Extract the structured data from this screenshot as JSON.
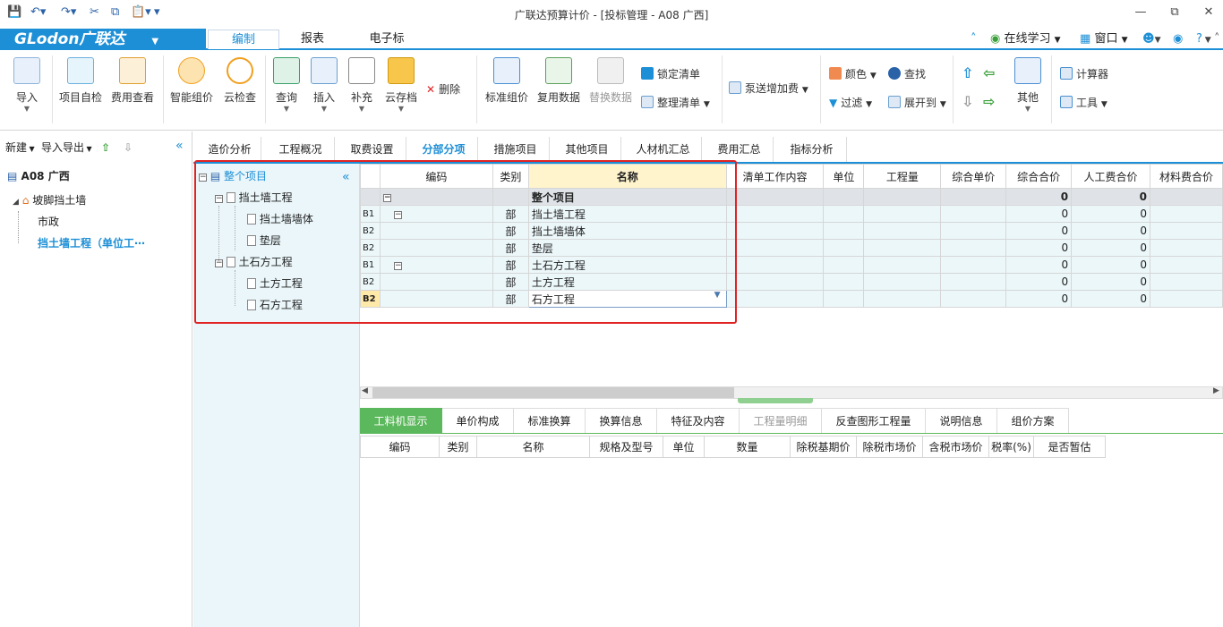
{
  "window": {
    "title": "广联达预算计价 - [投标管理 - A08 广西]"
  },
  "menu": {
    "logo": "GLodon广联达",
    "tabs": [
      "编制",
      "报表",
      "电子标"
    ],
    "right": {
      "online": "在线学习",
      "window": "窗口",
      "help": "?"
    }
  },
  "ribbon": {
    "import": "导入",
    "self_check": "项目自检",
    "fee_view": "费用查看",
    "smart_price": "智能组价",
    "cloud_check": "云检查",
    "query": "查询",
    "insert": "插入",
    "supplement": "补充",
    "cloud_archive": "云存档",
    "delete": "删除",
    "std_price": "标准组价",
    "reuse_data": "复用数据",
    "replace_data": "替换数据",
    "lock_list": "锁定清单",
    "organize_list": "整理清单",
    "pump_fee": "泵送增加费",
    "color": "颜色",
    "find": "查找",
    "filter": "过滤",
    "expand_to": "展开到",
    "other": "其他",
    "calculator": "计算器",
    "tools": "工具"
  },
  "left_panel": {
    "new": "新建",
    "import_export": "导入导出",
    "project": "A08 广西",
    "tree": [
      "坡脚挡土墙",
      "市政",
      "挡土墙工程（单位工⋯"
    ]
  },
  "sub_tabs": [
    "造价分析",
    "工程概况",
    "取费设置",
    "分部分项",
    "措施项目",
    "其他项目",
    "人材机汇总",
    "费用汇总",
    "指标分析"
  ],
  "nav_tree": {
    "root": "整个项目",
    "items": [
      {
        "label": "挡土墙工程",
        "children": [
          "挡土墙墙体",
          "垫层"
        ]
      },
      {
        "label": "土石方工程",
        "children": [
          "土方工程",
          "石方工程"
        ]
      }
    ]
  },
  "grid": {
    "columns": [
      "编码",
      "类别",
      "名称",
      "清单工作内容",
      "单位",
      "工程量",
      "综合单价",
      "综合合价",
      "人工费合价",
      "材料费合价"
    ],
    "rows": [
      {
        "lvl": "",
        "type": "",
        "name": "整个项目",
        "total": "0",
        "labor": "0"
      },
      {
        "lvl": "B1",
        "type": "部",
        "name": "挡土墙工程",
        "total": "0",
        "labor": "0"
      },
      {
        "lvl": "B2",
        "type": "部",
        "name": "挡土墙墙体",
        "total": "0",
        "labor": "0"
      },
      {
        "lvl": "B2",
        "type": "部",
        "name": "垫层",
        "total": "0",
        "labor": "0"
      },
      {
        "lvl": "B1",
        "type": "部",
        "name": "土石方工程",
        "total": "0",
        "labor": "0"
      },
      {
        "lvl": "B2",
        "type": "部",
        "name": "土方工程",
        "total": "0",
        "labor": "0"
      },
      {
        "lvl": "B2",
        "type": "部",
        "name": "石方工程",
        "total": "0",
        "labor": "0"
      }
    ]
  },
  "bottom_tabs": [
    "工料机显示",
    "单价构成",
    "标准换算",
    "换算信息",
    "特征及内容",
    "工程量明细",
    "反查图形工程量",
    "说明信息",
    "组价方案"
  ],
  "bottom_grid": {
    "columns": [
      "编码",
      "类别",
      "名称",
      "规格及型号",
      "单位",
      "数量",
      "除税基期价",
      "除税市场价",
      "含税市场价",
      "税率(%)",
      "是否暂估"
    ]
  },
  "colors": {
    "accent": "#1d8fd6",
    "green_tab": "#5cb85c",
    "highlight": "#e02424"
  }
}
